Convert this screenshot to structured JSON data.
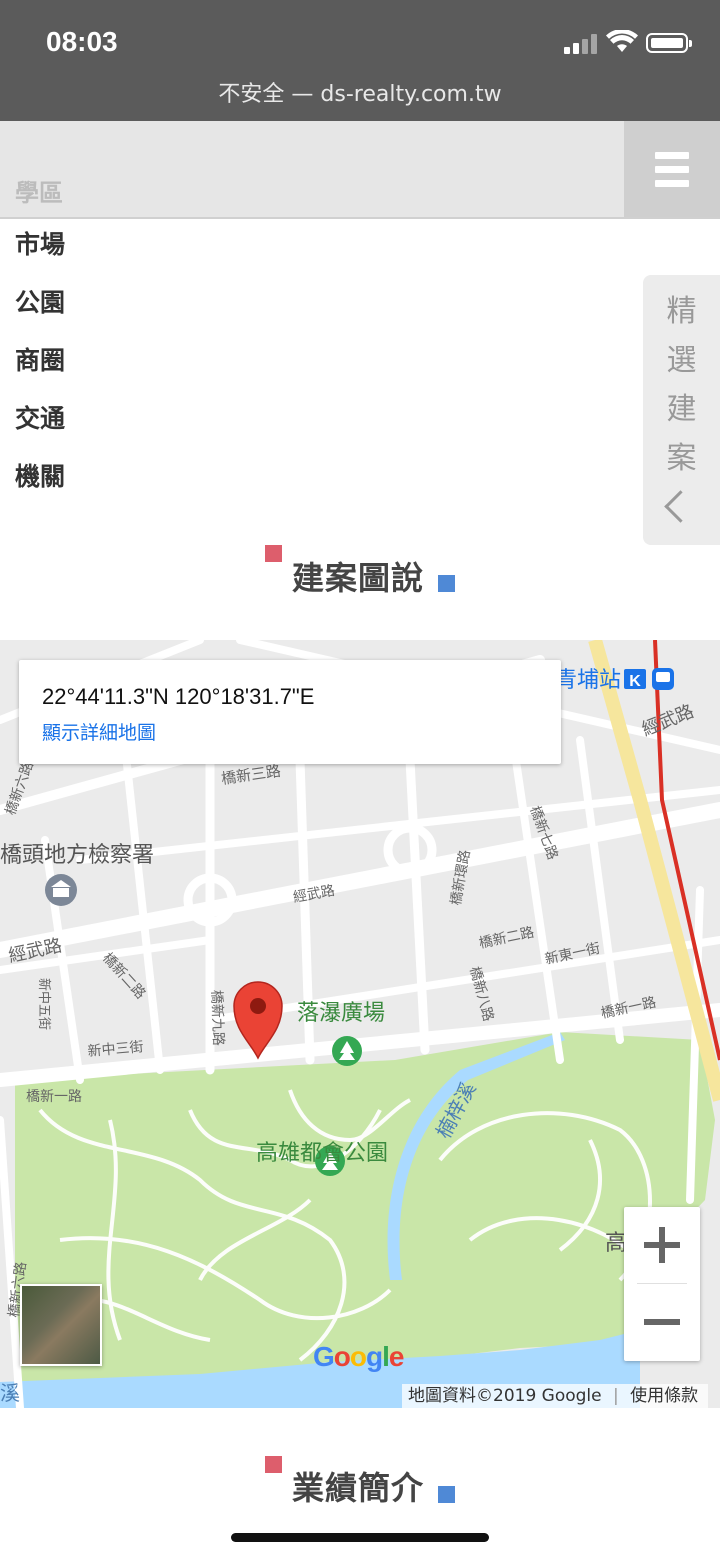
{
  "status_bar": {
    "time": "08:03"
  },
  "browser": {
    "url_text": "不安全 — ds-realty.com.tw"
  },
  "nav": {
    "faded_item": "學區",
    "menu_items": [
      "市場",
      "公園",
      "商圈",
      "交通",
      "機關"
    ]
  },
  "side_tab": {
    "chars": [
      "精",
      "選",
      "建",
      "案"
    ]
  },
  "sections": {
    "map_title": "建案圖說",
    "next_title": "業績簡介"
  },
  "map": {
    "coordinates": "22°44'11.3\"N 120°18'31.7\"E",
    "detail_link": "顯示詳細地圖",
    "attribution_data": "地圖資料©2019 Google",
    "attribution_terms": "使用條款",
    "logo": "Google",
    "labels": {
      "prosecutors": "橋頭地方檢察署",
      "plaza": "落瀑廣場",
      "park": "高雄都會公園",
      "creek": "楠梓溪",
      "station": "青埔站",
      "edge_gao": "高",
      "edge_xi": "溪",
      "jingwu_right": "經武路",
      "jingwu_left": "經武路",
      "jingwu_mid": "經武路",
      "qiaoxin_3": "橋新三路",
      "qiaoxin_2a": "橋新二路",
      "qiaoxin_2b": "橋新二路",
      "qiaoxin_1a": "橋新一路",
      "qiaoxin_1b": "橋新一路",
      "qiaoxin_7": "橋新七路",
      "qiaoxin_8": "橋新八路",
      "qiaoxin_9": "橋新九路",
      "qiaoxin_6": "橋新六路",
      "qiaoxin_6b": "橋新六路",
      "qiaoxin_ring": "橋新環路",
      "xindong_1": "新東一街",
      "xinzhong_3": "新中三街",
      "xinzhong_5": "新中五街"
    }
  },
  "colors": {
    "status_bg": "#5b5b5b",
    "accent_red": "#dd5e6c",
    "accent_blue": "#4f89d6",
    "park_green": "#c9e6a8",
    "pin_red": "#ea4335",
    "rail_red": "#d93025",
    "river_blue": "#aadaff"
  },
  "icons": [
    "signal-icon",
    "wifi-icon",
    "battery-icon",
    "menu-icon",
    "chevron-left-icon",
    "map-pin-icon",
    "tree-icon",
    "landmark-icon",
    "metro-icon",
    "zoom-in-icon",
    "zoom-out-icon"
  ]
}
